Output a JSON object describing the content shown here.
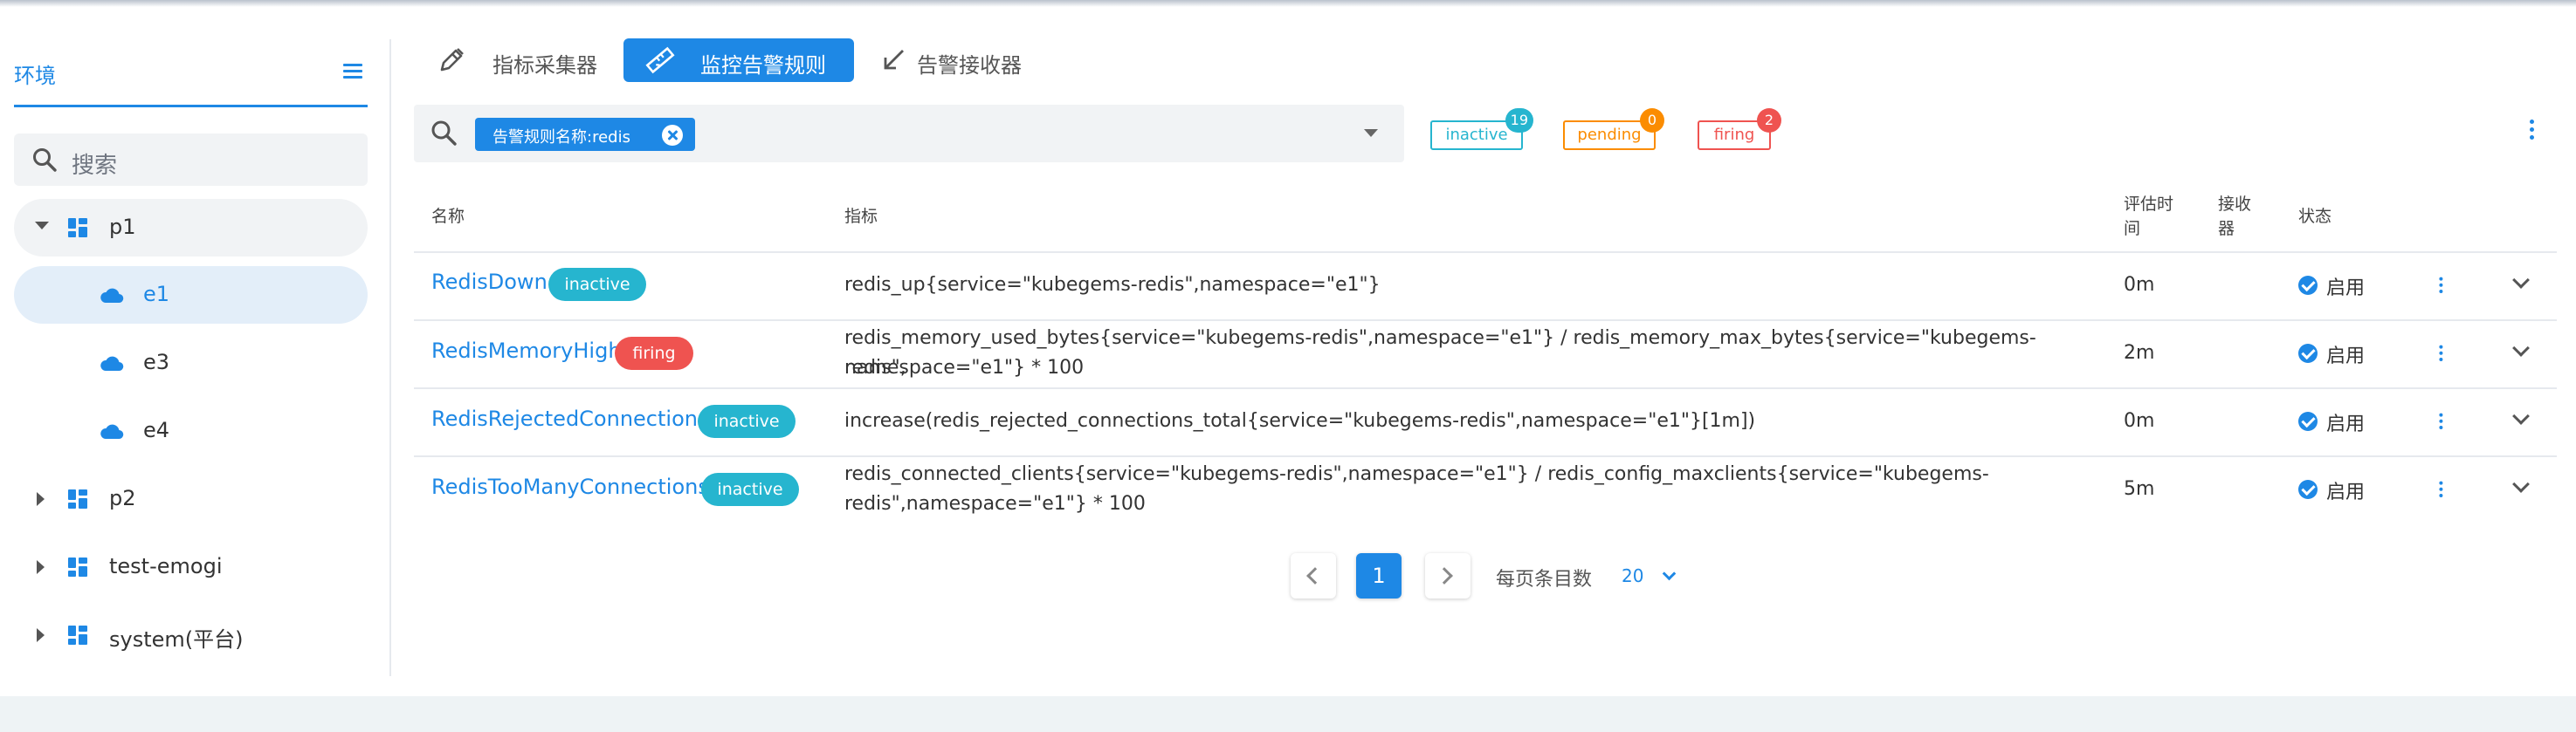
{
  "sidebar": {
    "title": "环境",
    "search_placeholder": "搜索",
    "tree": [
      {
        "label": "p1",
        "expanded": true,
        "children": [
          {
            "label": "e1",
            "selected": true
          },
          {
            "label": "e3"
          },
          {
            "label": "e4"
          }
        ]
      },
      {
        "label": "p2"
      },
      {
        "label": "test-emogi"
      },
      {
        "label": "system(平台)"
      }
    ]
  },
  "tabs": [
    {
      "label": "指标采集器",
      "icon": "pen-icon"
    },
    {
      "label": "监控告警规则",
      "icon": "ruler-icon",
      "active": true
    },
    {
      "label": "告警接收器",
      "icon": "arrow-down-left-icon"
    }
  ],
  "filter": {
    "chip_label": "告警规则名称:redis"
  },
  "legend": {
    "inactive": {
      "label": "inactive",
      "count": "19"
    },
    "pending": {
      "label": "pending",
      "count": "0"
    },
    "firing": {
      "label": "firing",
      "count": "2"
    }
  },
  "table": {
    "headers": {
      "name": "名称",
      "expr": "指标",
      "eval_line1": "评估时",
      "eval_line2": "间",
      "receiver_line1": "接收",
      "receiver_line2": "器",
      "status": "状态"
    },
    "rows": [
      {
        "name": "RedisDown",
        "state": "inactive",
        "expr_line1": "redis_up{service=\"kubegems-redis\",namespace=\"e1\"}",
        "expr_line2": "",
        "eval": "0m",
        "status": "启用"
      },
      {
        "name": "RedisMemoryHigh",
        "state": "firing",
        "expr_line1": "redis_memory_used_bytes{service=\"kubegems-redis\",namespace=\"e1\"} / redis_memory_max_bytes{service=\"kubegems-redis\",",
        "expr_line2": "namespace=\"e1\"} * 100",
        "eval": "2m",
        "status": "启用"
      },
      {
        "name": "RedisRejectedConnections",
        "state": "inactive",
        "expr_line1": "increase(redis_rejected_connections_total{service=\"kubegems-redis\",namespace=\"e1\"}[1m])",
        "expr_line2": "",
        "eval": "0m",
        "status": "启用"
      },
      {
        "name": "RedisTooManyConnections",
        "state": "inactive",
        "expr_line1": "redis_connected_clients{service=\"kubegems-redis\",namespace=\"e1\"} / redis_config_maxclients{service=\"kubegems-",
        "expr_line2": "redis\",namespace=\"e1\"} * 100",
        "eval": "5m",
        "status": "启用"
      }
    ]
  },
  "pagination": {
    "current_page": "1",
    "page_size_label": "每页条目数",
    "page_size": "20"
  },
  "colors": {
    "accent": "#1e88e5",
    "inactive": "#26b5cf",
    "pending": "#fb8c00",
    "firing": "#ef5350"
  }
}
